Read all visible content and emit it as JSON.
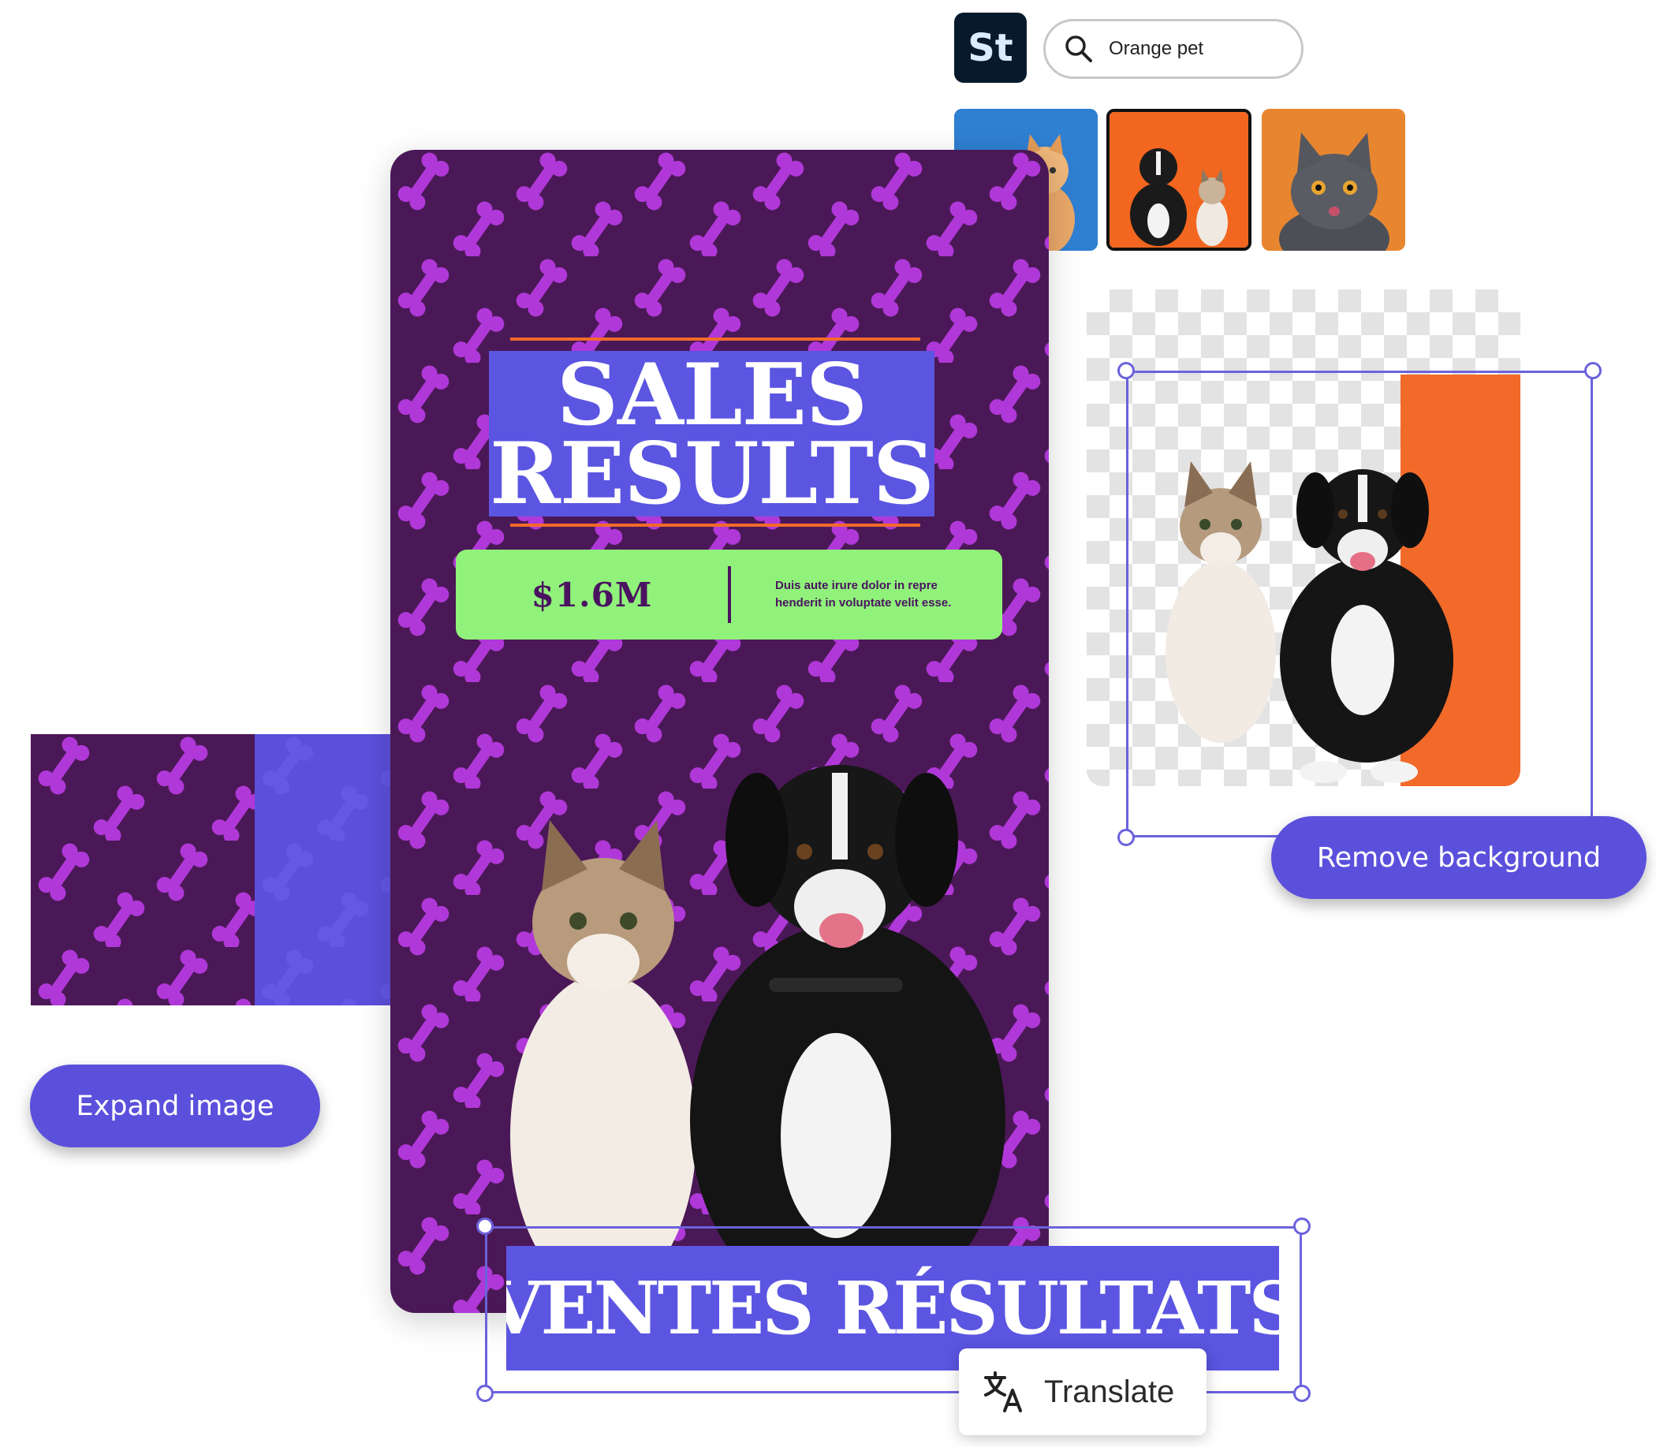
{
  "stock": {
    "logo_label": "St",
    "search_value": "Orange pet"
  },
  "thumbnails": [
    {
      "name": "orange-kitten",
      "bg": "#2f7fd2",
      "selected": false
    },
    {
      "name": "dog-and-cat-orange",
      "bg": "#f2661f",
      "selected": true
    },
    {
      "name": "grey-cat-orange",
      "bg": "#e8862f",
      "selected": false
    }
  ],
  "poster": {
    "title_line1": "SALES",
    "title_line2": "RESULTS",
    "stat_value": "$1.6M",
    "stat_desc_line1": "Duis aute irure dolor in repre",
    "stat_desc_line2": "henderit in voluptate velit esse."
  },
  "actions": {
    "remove_background": "Remove background",
    "expand_image": "Expand image",
    "translate": "Translate"
  },
  "translation": {
    "text": "VENTES RÉSULTATS"
  },
  "colors": {
    "accent": "#5b50dc",
    "poster_bg": "#4b1857",
    "stat_bg": "#90f27a",
    "orange": "#f26a2a"
  }
}
